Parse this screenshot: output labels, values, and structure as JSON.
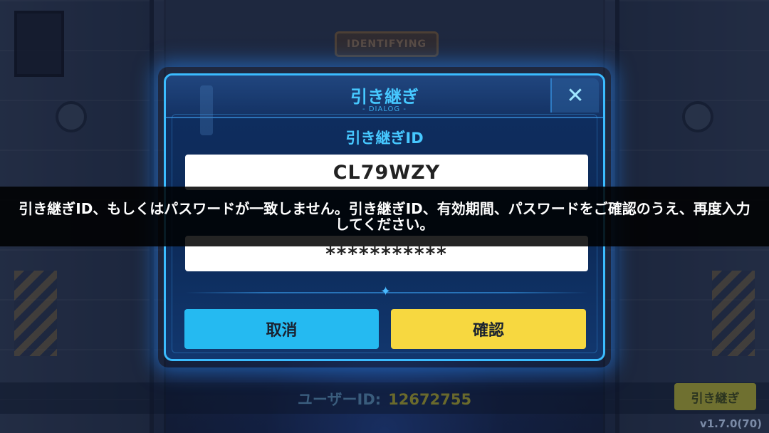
{
  "background": {
    "sign_text": "IDENTIFYING"
  },
  "dialog": {
    "title": "引き継ぎ",
    "subtitle": "- DIALOG -",
    "close_label": "✕",
    "id_label": "引き継ぎID",
    "id_value": "CL79WZY",
    "password_value": "***********",
    "cancel_label": "取消",
    "confirm_label": "確認"
  },
  "toast": {
    "message": "引き継ぎID、もしくはパスワードが一致しません。引き継ぎID、有効期間、パスワードをご確認のうえ、再度入力してください。"
  },
  "footer": {
    "user_id_label": "ユーザーID:",
    "user_id_value": "12672755",
    "transfer_button_label": "引き継ぎ",
    "version": "v1.7.0(70)"
  },
  "colors": {
    "accent_cyan": "#46c8ff",
    "cancel_button": "#25baf1",
    "confirm_button": "#f7d840",
    "dialog_bg": "#0f2e60"
  }
}
